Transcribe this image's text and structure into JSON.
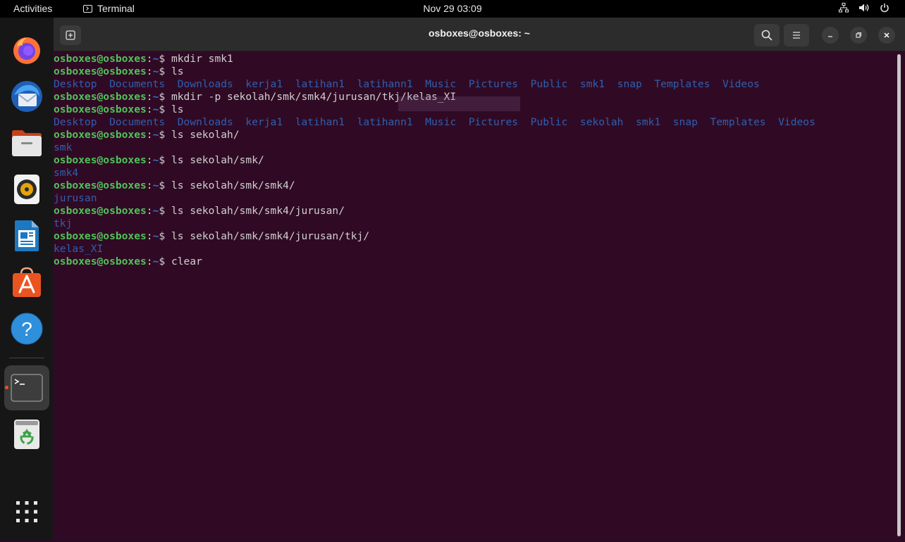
{
  "topbar": {
    "activities": "Activities",
    "app_name": "Terminal",
    "datetime": "Nov 29  03:09",
    "tray_icons": [
      "network-icon",
      "volume-icon",
      "power-icon"
    ]
  },
  "dock": {
    "items": [
      {
        "name": "firefox",
        "icon": "firefox-icon"
      },
      {
        "name": "thunderbird",
        "icon": "thunderbird-icon"
      },
      {
        "name": "files",
        "icon": "files-icon"
      },
      {
        "name": "rhythmbox",
        "icon": "rhythmbox-icon"
      },
      {
        "name": "libreoffice-writer",
        "icon": "writer-icon"
      },
      {
        "name": "ubuntu-software",
        "icon": "software-icon"
      },
      {
        "name": "help",
        "icon": "help-icon"
      },
      {
        "name": "terminal",
        "icon": "terminal-icon",
        "active": true
      },
      {
        "name": "trash",
        "icon": "trash-icon"
      },
      {
        "name": "show-apps",
        "icon": "app-grid-icon"
      }
    ]
  },
  "window": {
    "title": "osboxes@osboxes: ~"
  },
  "terminal": {
    "prompt_user": "osboxes@osboxes",
    "prompt_sep": ":",
    "prompt_path": "~",
    "prompt_symbol": "$ ",
    "lines": [
      {
        "type": "cmd",
        "text": "mkdir smk1"
      },
      {
        "type": "cmd",
        "text": "ls"
      },
      {
        "type": "dirs",
        "items": [
          "Desktop",
          "Documents",
          "Downloads",
          "kerja1",
          "latihan1",
          "latihann1",
          "Music",
          "Pictures",
          "Public",
          "smk1",
          "snap",
          "Templates",
          "Videos"
        ]
      },
      {
        "type": "cmd",
        "text": "mkdir -p sekolah/smk/smk4/jurusan/tkj/kelas_XI"
      },
      {
        "type": "cmd",
        "text": "ls"
      },
      {
        "type": "dirs",
        "items": [
          "Desktop",
          "Documents",
          "Downloads",
          "kerja1",
          "latihan1",
          "latihann1",
          "Music",
          "Pictures",
          "Public",
          "sekolah",
          "smk1",
          "snap",
          "Templates",
          "Videos"
        ]
      },
      {
        "type": "cmd",
        "text": "ls sekolah/"
      },
      {
        "type": "dirs",
        "items": [
          "smk"
        ]
      },
      {
        "type": "cmd",
        "text": "ls sekolah/smk/"
      },
      {
        "type": "dirs",
        "items": [
          "smk4"
        ]
      },
      {
        "type": "cmd",
        "text": "ls sekolah/smk/smk4/"
      },
      {
        "type": "dirs",
        "items": [
          "jurusan"
        ]
      },
      {
        "type": "cmd",
        "text": "ls sekolah/smk/smk4/jurusan/"
      },
      {
        "type": "dirs",
        "items": [
          "tkj"
        ]
      },
      {
        "type": "cmd",
        "text": "ls sekolah/smk/smk4/jurusan/tkj/"
      },
      {
        "type": "dirs",
        "items": [
          "kelas_XI"
        ]
      },
      {
        "type": "cmd",
        "text": "clear"
      }
    ]
  },
  "colors": {
    "terminal_bg": "#300a24",
    "prompt_user": "#4fc35a",
    "directory": "#2f5fb0",
    "accent": "#e95420"
  }
}
